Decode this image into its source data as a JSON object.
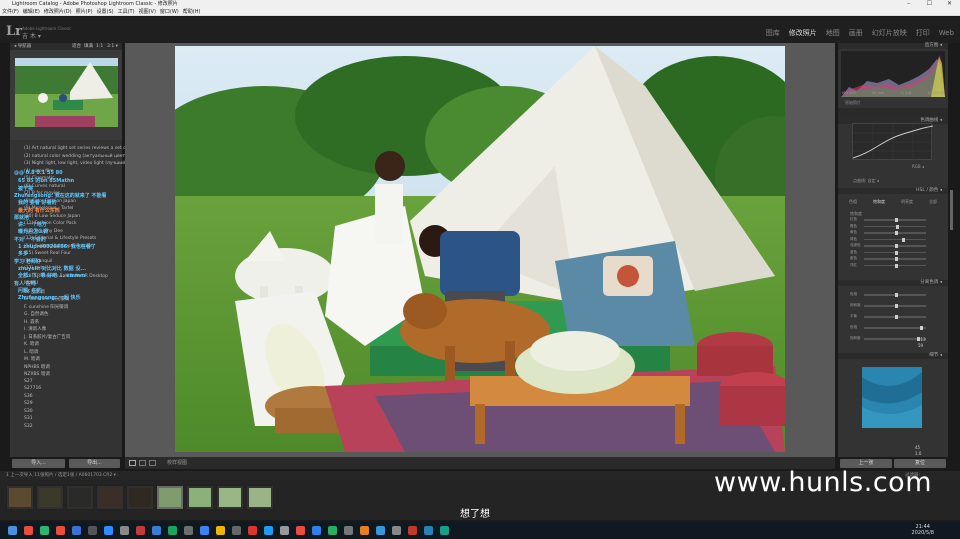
{
  "window": {
    "title": "Lightroom Catalog - Adobe Photoshop Lightroom Classic - 修改照片",
    "controls": [
      "–",
      "☐",
      "✕"
    ]
  },
  "menu": [
    "文件(F)",
    "编辑(E)",
    "修改照片(D)",
    "照片(P)",
    "设置(S)",
    "工具(T)",
    "视图(V)",
    "窗口(W)",
    "帮助(H)"
  ],
  "identity": {
    "logo": "Lr",
    "app_small": "Adobe Lightroom Classic",
    "user": "吉 木 ▾",
    "modules": [
      "图库",
      "修改照片",
      "地图",
      "画册",
      "幻灯片放映",
      "打印",
      "Web"
    ],
    "active_module": "修改照片"
  },
  "left_panel": {
    "navigator_label": "◂ 导航器",
    "nav_options": [
      "适合",
      "填满",
      "1:1",
      "3:1 ▾"
    ],
    "presets": [
      "(1) Art natural light set series reviews a set of ...",
      "(2) natural color wedding (актуальный цвет -хо...",
      "(3) Night light, low light, video light (лучший ноч...",
      "(4) outer film",
      "(5) Cinematic",
      "(6) Curves natural",
      "(7) B for movies",
      "(8) Color Fashion Japan",
      "(9) Monologue - Tartel",
      "(10) B Low Seduce Japan",
      "(11) Fashion Color Pack",
      "(12) Dreamy Dee",
      "(13) Editorial & Lifestyle Presets",
      "(14) Yuzhen Lightroom Presets",
      "(15) Sweet Real Four",
      "(16) Tranquil",
      "(17) pnb",
      "(18) LR Presets Bali Suite LR Desktop",
      "MUMU",
      "04 乱影调",
      "E. sunshine 阳光暖调",
      "F. sunshine 阳光暖调",
      "G. 自然调色",
      "H. 森系",
      "I. 清新人像",
      "J. 日系胶片/复古广告风",
      "K. 暗调",
      "L. 暗调",
      "M. 暗调",
      "NPHBS 暗调",
      "NZXBS 暗调",
      "S27",
      "S27716",
      "S36",
      "S29",
      "S30",
      "S31",
      "S32"
    ],
    "danmaku": [
      {
        "t": "@@ 0.8 0.1 55   80",
        "c": "#5ec8ff"
      },
      {
        "t": "   65     85 的bn 85Mathn",
        "c": "#5ec8ff"
      },
      {
        "t": "被干得",
        "c": "#5ec8ff"
      },
      {
        "t": "Zhufengsong: 我在这的就来了 不能看",
        "c": "#5ec8ff"
      },
      {
        "t": "我的 要看 好看的",
        "c": "#5ec8ff"
      },
      {
        "t": "最大的  有什么东西",
        "c": "#ff8844"
      },
      {
        "t": "那就用",
        "c": "#5ec8ff"
      },
      {
        "t": "讲:  一个地方",
        "c": "#5ec8ff"
      },
      {
        "t": "曝光后怎么调",
        "c": "#5ec8ff"
      },
      {
        "t": "不对 一不会的",
        "c": "#5ec8ff"
      },
      {
        "t": "1 zhupro0026466: 我也在看了",
        "c": "#5ec8ff"
      },
      {
        "t": "多多",
        "c": "#5ec8ff"
      },
      {
        "t": "学习 老师好",
        "c": "#5ec8ff"
      },
      {
        "t": "zhuyeli: 对比对比 数据 没...",
        "c": "#5ec8ff"
      },
      {
        "t": "全部: 下, 嗯 好吧 ... emmm",
        "c": "#5ec8ff"
      },
      {
        "t": "有人 在吗",
        "c": "#5ec8ff"
      },
      {
        "t": "问题: 在的",
        "c": "#5ec8ff"
      },
      {
        "t": "Zhufengsong: 一起 快乐",
        "c": "#5ec8ff"
      }
    ],
    "import_btn": "导入...",
    "export_btn": "导出..."
  },
  "right_panel": {
    "histogram_label": "直方图 ◂",
    "histogram_values": [
      "ISO 250",
      "50 mm",
      "f / 2.8",
      "1/2000 秒"
    ],
    "original_label": "原始照片",
    "tone_curve_label": "色调曲线 ◂",
    "channel_label": "RGB ◂",
    "point_curve_label": "点曲线: 自定 ◂",
    "hsl_label": "HSL / 颜色 ◂",
    "hsl_tabs": [
      "色相",
      "饱和度",
      "明亮度",
      "全部"
    ],
    "hsl_sub": "饱和度",
    "hsl_colors": [
      "红色",
      "橙色",
      "黄色",
      "绿色",
      "浅绿色",
      "蓝色",
      "紫色",
      "洋红"
    ],
    "hsl_values": [
      0.5,
      0.52,
      0.5,
      0.62,
      0.5,
      0.5,
      0.5,
      0.5
    ],
    "split_label": "分离色调 ◂",
    "split_rows": [
      {
        "name": "色相",
        "v": 0.5
      },
      {
        "name": "饱和度",
        "v": 0.5
      },
      {
        "name": "平衡",
        "v": 0.5
      },
      {
        "name": "色相",
        "v": 0.9
      },
      {
        "name": "饱和度",
        "v": 0.85
      }
    ],
    "split_values": [
      "213",
      "59"
    ],
    "detail_label": "细节 ◂",
    "detail_values": [
      "45",
      "1.0"
    ],
    "prev_btn": "上一张",
    "reset_btn": "复位"
  },
  "toolbar": {
    "softproof": "校样视图"
  },
  "filmstrip": {
    "info": "1  上一次导入  11张照片 / 选定1张 / A0601703.CR2 ▾",
    "filter": "过滤器:",
    "thumbs": [
      {
        "c": "#5a4a30"
      },
      {
        "c": "#3b3a2a"
      },
      {
        "c": "#2a2a28"
      },
      {
        "c": "#3a2e28"
      },
      {
        "c": "#2e2a22"
      },
      {
        "c": "#7e9c6e"
      },
      {
        "c": "#8cb07a"
      },
      {
        "c": "#98b686"
      },
      {
        "c": "#9ab488"
      }
    ]
  },
  "overlay": {
    "watermark": "www.hunls.com",
    "subtitle": "想了想"
  },
  "taskbar": {
    "time": "21:44",
    "date": "2020/5/8"
  }
}
